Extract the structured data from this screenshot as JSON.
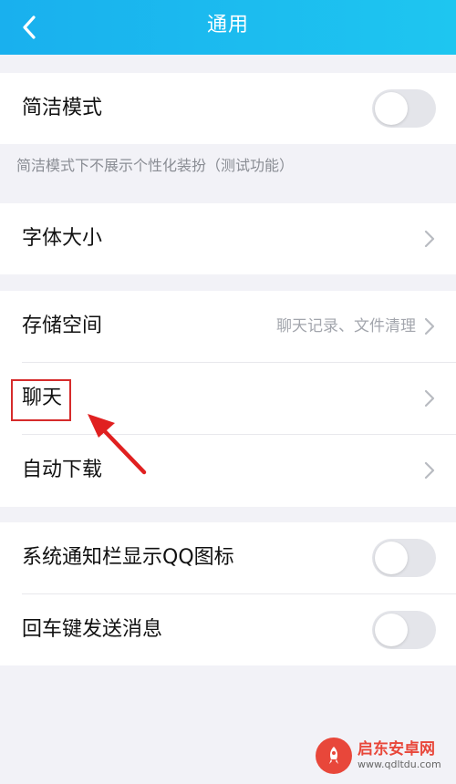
{
  "header": {
    "title": "通用",
    "back_icon": "chevron-left-icon",
    "background": "#1ab8ef"
  },
  "sections": {
    "simple_mode": {
      "label": "简洁模式",
      "toggle_on": false,
      "caption": "简洁模式下不展示个性化装扮（测试功能）"
    },
    "font_size": {
      "label": "字体大小"
    },
    "storage": {
      "label": "存储空间",
      "value": "聊天记录、文件清理"
    },
    "chat": {
      "label": "聊天"
    },
    "auto_download": {
      "label": "自动下载"
    },
    "notification_qq_icon": {
      "label": "系统通知栏显示QQ图标",
      "toggle_on": false
    },
    "enter_send": {
      "label": "回车键发送消息",
      "toggle_on": false
    }
  },
  "annotation": {
    "highlight_color": "#d62b2b",
    "arrow_icon": "red-arrow-icon"
  },
  "watermark": {
    "brand": "启东安卓网",
    "url": "www.qdltdu.com",
    "color": "#e8473a"
  }
}
